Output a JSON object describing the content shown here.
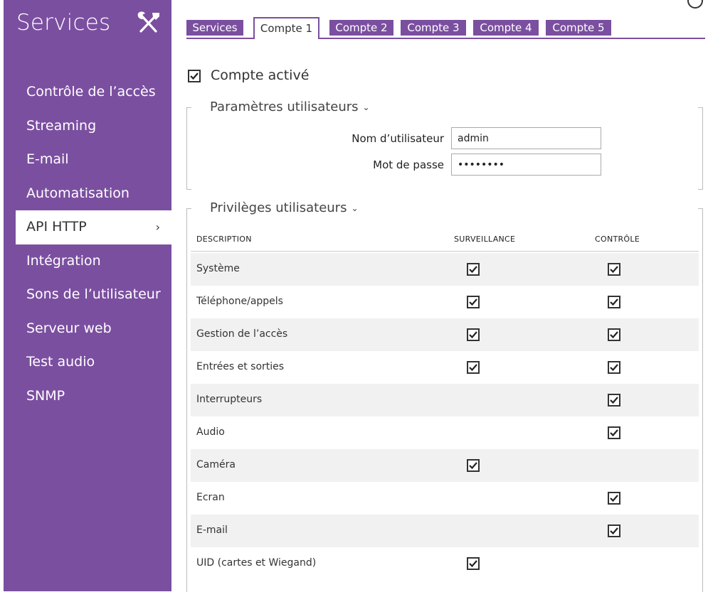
{
  "sidebar": {
    "title": "Services",
    "icon": "tools-icon",
    "items": [
      {
        "label": "Contrôle de l’accès",
        "active": false
      },
      {
        "label": "Streaming",
        "active": false
      },
      {
        "label": "E-mail",
        "active": false
      },
      {
        "label": "Automatisation",
        "active": false
      },
      {
        "label": "API HTTP",
        "active": true
      },
      {
        "label": "Intégration",
        "active": false
      },
      {
        "label": "Sons de l’utilisateur",
        "active": false
      },
      {
        "label": "Serveur web",
        "active": false
      },
      {
        "label": "Test audio",
        "active": false
      },
      {
        "label": "SNMP",
        "active": false
      }
    ],
    "active_chevron": "›"
  },
  "tabs": [
    {
      "label": "Services",
      "active": false
    },
    {
      "label": "Compte 1",
      "active": true
    },
    {
      "label": "Compte 2",
      "active": false
    },
    {
      "label": "Compte 3",
      "active": false
    },
    {
      "label": "Compte 4",
      "active": false
    },
    {
      "label": "Compte 5",
      "active": false
    }
  ],
  "account": {
    "label": "Compte activé",
    "checked": true
  },
  "user_params": {
    "title": "Paramètres utilisateurs",
    "username_label": "Nom d’utilisateur",
    "username_value": "admin",
    "password_label": "Mot de passe",
    "password_value": "••••••••"
  },
  "privileges": {
    "title": "Privilèges utilisateurs",
    "columns": [
      "DESCRIPTION",
      "SURVEILLANCE",
      "CONTRÔLE"
    ],
    "rows": [
      {
        "description": "Système",
        "surveillance": true,
        "control": true
      },
      {
        "description": "Téléphone/appels",
        "surveillance": true,
        "control": true
      },
      {
        "description": "Gestion de l’accès",
        "surveillance": true,
        "control": true
      },
      {
        "description": "Entrées et sorties",
        "surveillance": true,
        "control": true
      },
      {
        "description": "Interrupteurs",
        "surveillance": false,
        "control": true
      },
      {
        "description": "Audio",
        "surveillance": false,
        "control": true
      },
      {
        "description": "Caméra",
        "surveillance": true,
        "control": false
      },
      {
        "description": "Ecran",
        "surveillance": false,
        "control": true
      },
      {
        "description": "E-mail",
        "surveillance": false,
        "control": true
      },
      {
        "description": "UID (cartes et Wiegand)",
        "surveillance": true,
        "control": false
      }
    ]
  },
  "colors": {
    "accent": "#7b4fa0"
  }
}
